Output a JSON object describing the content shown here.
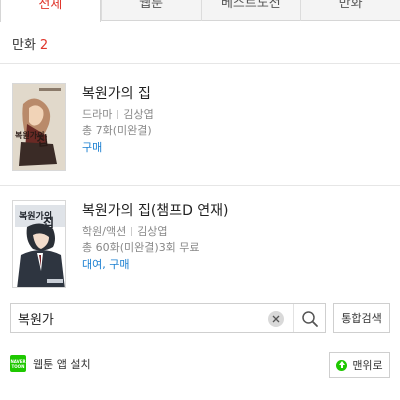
{
  "tabs": [
    {
      "label": "전체",
      "active": true
    },
    {
      "label": "웹툰",
      "active": false
    },
    {
      "label": "베스트도전",
      "active": false
    },
    {
      "label": "만화",
      "active": false
    }
  ],
  "section": {
    "label": "만화",
    "count": "2"
  },
  "results": [
    {
      "title": "복원가의 집",
      "genre": "드라마",
      "author": "김상엽",
      "episodes": "총 7화(미완결)",
      "free": "",
      "purchase": "구매",
      "cover_text": "복원가의 집"
    },
    {
      "title": "복원가의 집(챔프D 연재)",
      "genre": "학원/액션",
      "author": "김상엽",
      "episodes": "총 60화(미완결)",
      "free": "3회 무료",
      "purchase": "대여, 구매",
      "cover_text": "복원가의 집"
    }
  ],
  "search": {
    "value": "복원가",
    "placeholder": ""
  },
  "combined_search_label": "통합검색",
  "install": {
    "logo_text_top": "NAVER",
    "logo_text_bottom": "TOON",
    "label": "웹툰 앱 설치"
  },
  "back_to_top_label": "맨위로",
  "colors": {
    "accent_red": "#e0352b",
    "link_blue": "#1a7fd1",
    "brand_green": "#1ec800"
  }
}
